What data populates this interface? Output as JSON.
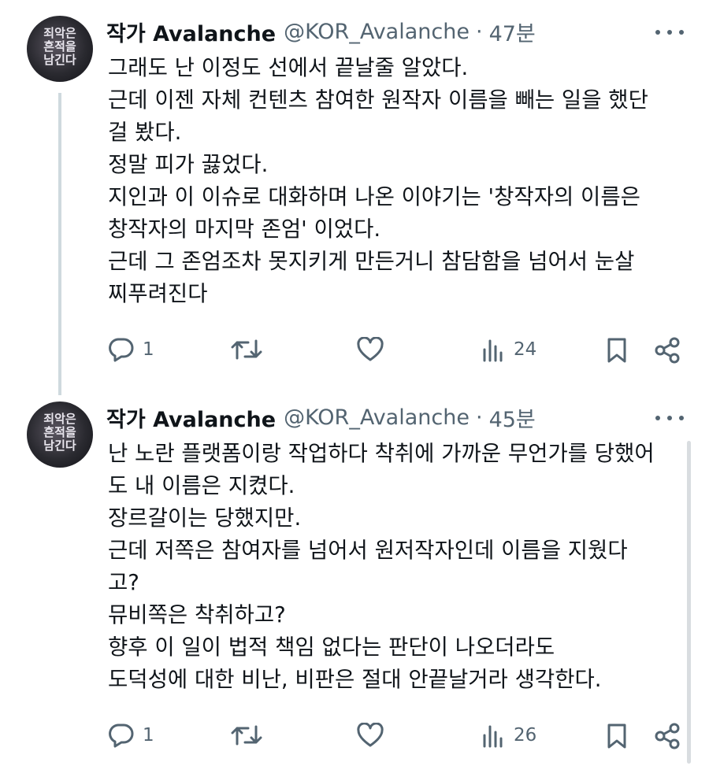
{
  "tweets": [
    {
      "author": {
        "name": "작가 Avalanche",
        "handle": "@KOR_Avalanche",
        "avatar_text": [
          "죄악은",
          "흔적을",
          "남긴다"
        ]
      },
      "separator": "·",
      "time": "47분",
      "lines": [
        "그래도 난 이정도 선에서 끝날줄 알았다.",
        "근데 이젠 자체 컨텐츠 참여한 원작자 이름을 빼는 일을 했단",
        "걸 봤다.",
        "정말 피가 끓었다.",
        "지인과 이 이슈로 대화하며 나온 이야기는 '창작자의 이름은",
        "창작자의 마지막 존엄' 이었다.",
        "근데 그 존엄조차 못지키게 만든거니 참담함을 넘어서 눈살",
        "찌푸려진다"
      ],
      "metrics": {
        "replies": "1",
        "reposts": "",
        "likes": "",
        "views": "24"
      }
    },
    {
      "author": {
        "name": "작가 Avalanche",
        "handle": "@KOR_Avalanche",
        "avatar_text": [
          "죄악은",
          "흔적을",
          "남긴다"
        ]
      },
      "separator": "·",
      "time": "45분",
      "lines": [
        "난 노란 플랫폼이랑 작업하다 착취에 가까운 무언가를 당했어",
        "도 내 이름은 지켰다.",
        "장르갈이는 당했지만.",
        "근데 저쪽은 참여자를 넘어서 원저작자인데 이름을 지웠다",
        "고?",
        "뮤비쪽은 착취하고?",
        "향후 이 일이 법적 책임 없다는 판단이 나오더라도",
        "도덕성에 대한 비난, 비판은 절대 안끝날거라 생각한다."
      ],
      "metrics": {
        "replies": "1",
        "reposts": "",
        "likes": "",
        "views": "26"
      }
    }
  ],
  "colors": {
    "text": "#0f1419",
    "secondary": "#536471",
    "thread_line": "#cfd9de"
  },
  "icons": [
    "more-icon",
    "reply-icon",
    "repost-icon",
    "like-icon",
    "views-icon",
    "bookmark-icon",
    "share-icon"
  ]
}
